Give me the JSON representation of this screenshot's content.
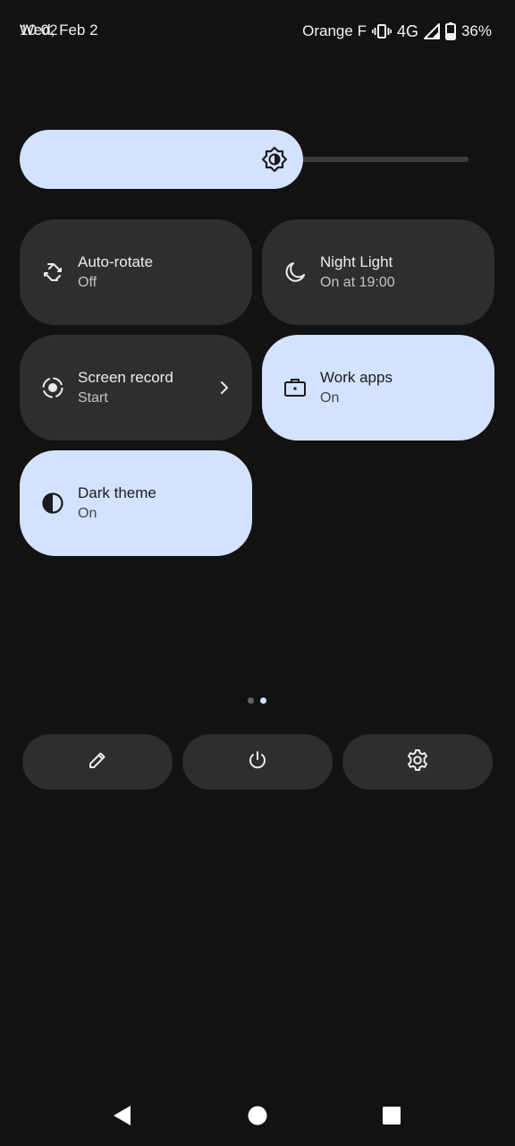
{
  "status_bar": {
    "time": "10:02",
    "date": "Wed, Feb 2",
    "carrier": "Orange F",
    "network": "4G",
    "battery": "36%",
    "icons": [
      "vibrate-icon",
      "signal-icon",
      "battery-icon"
    ]
  },
  "brightness": {
    "level": 0.63,
    "icon": "brightness-icon",
    "accent": "#d3e3fd"
  },
  "tiles": [
    {
      "title": "Auto-rotate",
      "subtitle": "Off",
      "icon": "auto-rotate-icon",
      "active": false
    },
    {
      "title": "Night Light",
      "subtitle": "On at 19:00",
      "icon": "night-light-icon",
      "active": false
    },
    {
      "title": "Screen record",
      "subtitle": "Start",
      "icon": "screen-record-icon",
      "active": false
    },
    {
      "title": "Work apps",
      "subtitle": "On",
      "icon": "work-apps-icon",
      "active": true
    },
    {
      "title": "Dark theme",
      "subtitle": "On",
      "icon": "dark-theme-icon",
      "active": true
    }
  ],
  "pager": {
    "pages": 2,
    "current": 2
  },
  "footer": [
    "edit-icon",
    "power-icon",
    "settings-icon"
  ],
  "nav": [
    "back-icon",
    "home-icon",
    "recents-icon"
  ],
  "colors": {
    "background": "#121212",
    "tile_inactive": "#2e2e2f",
    "tile_active": "#d3e3fd"
  }
}
